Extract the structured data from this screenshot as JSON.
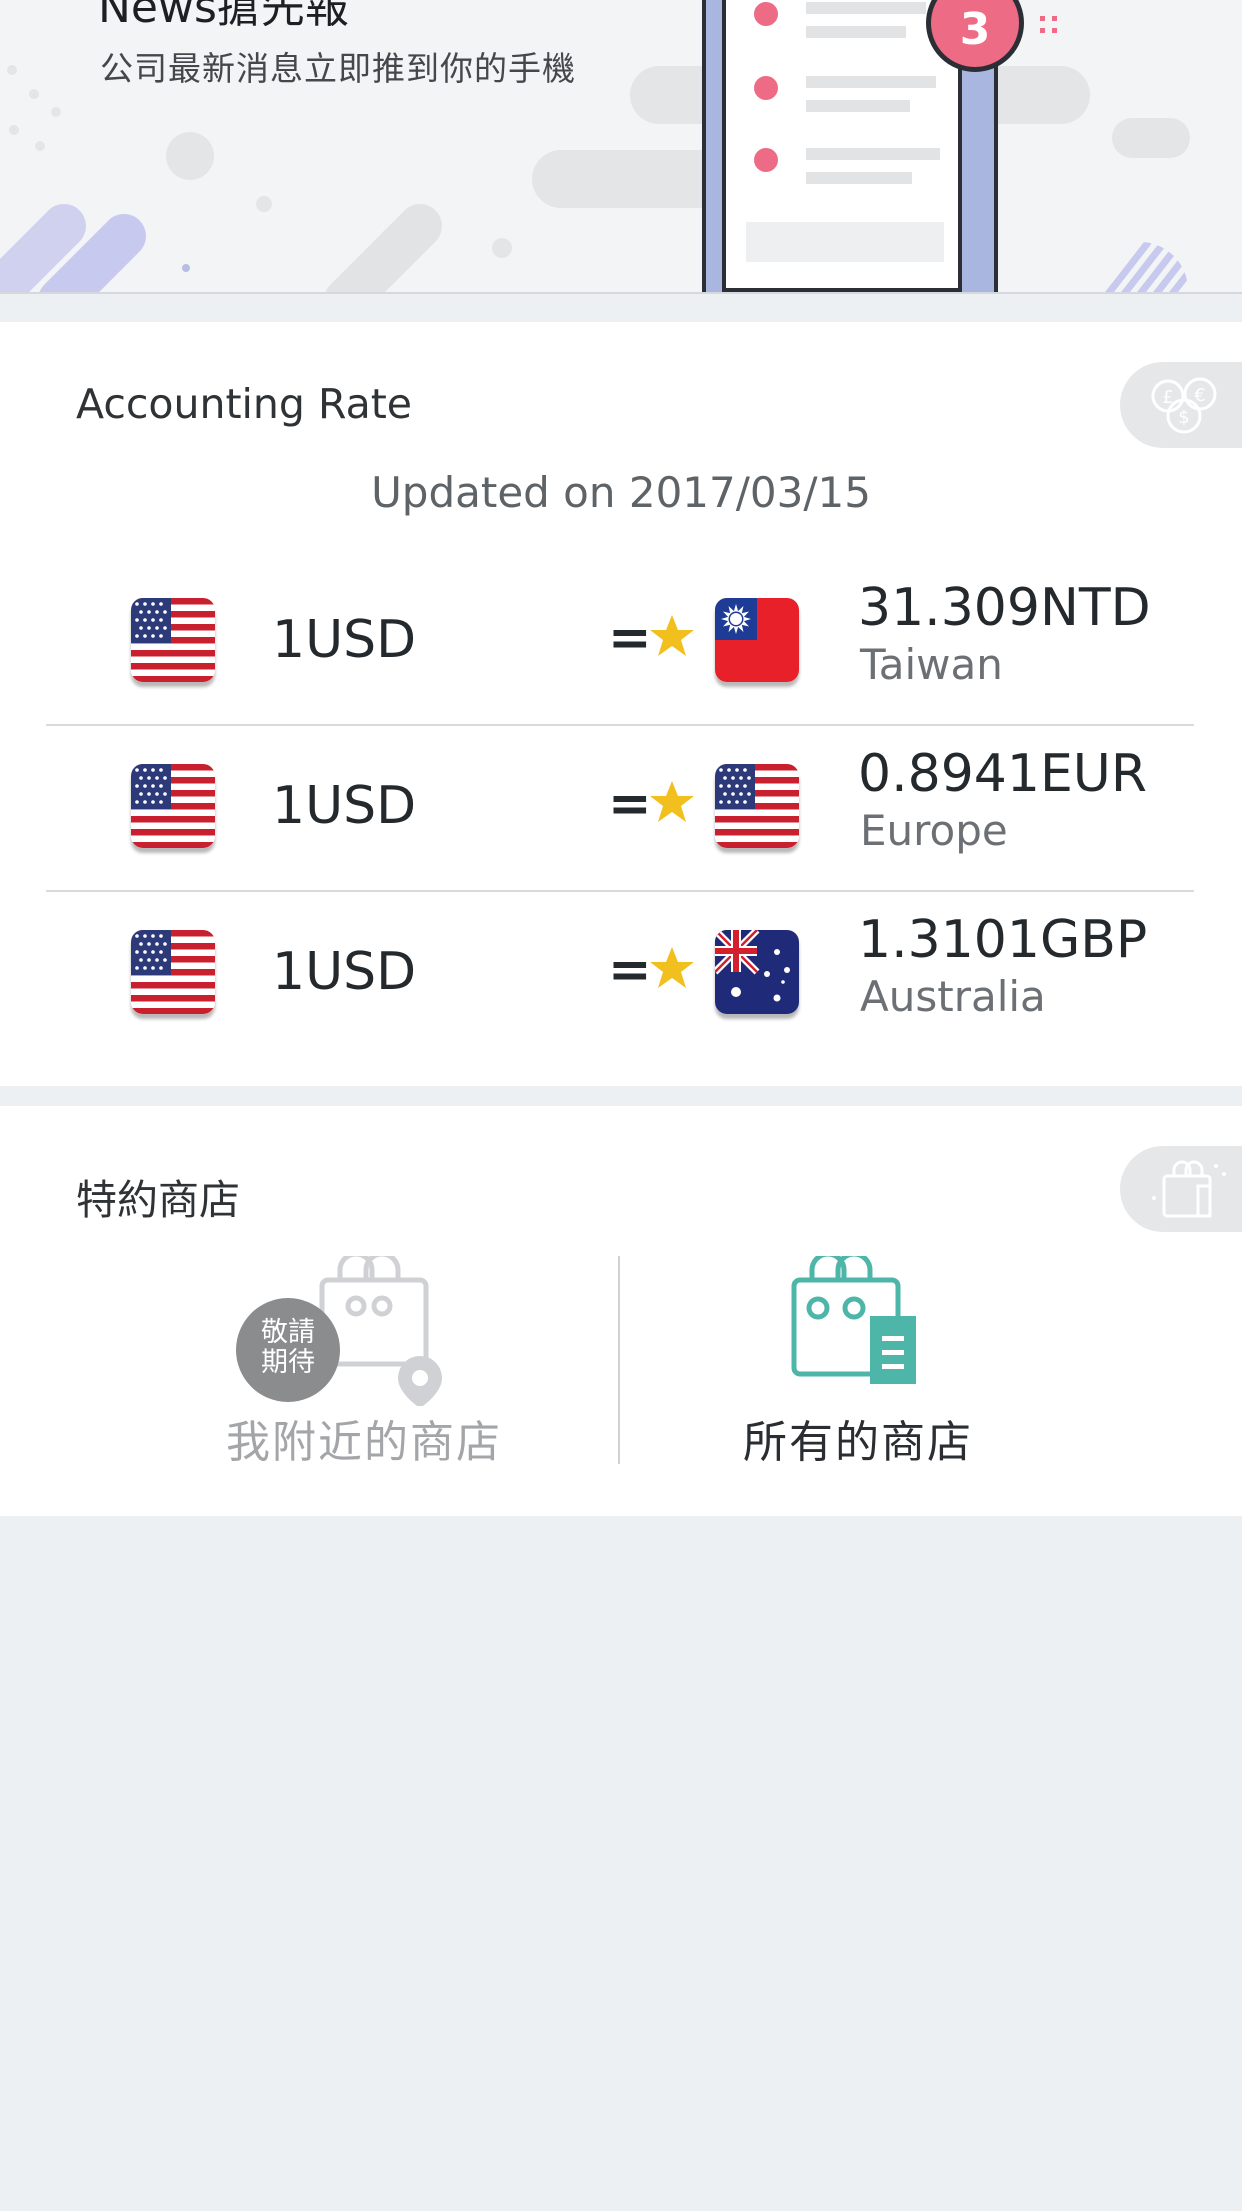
{
  "banner": {
    "title": "News搶先報",
    "subtitle": "公司最新消息立即推到你的手機",
    "notification_count": "3"
  },
  "accounting_rate": {
    "title": "Accounting Rate",
    "updated": "Updated on 2017/03/15",
    "badge_icon": "currency-coins-icon",
    "rows": [
      {
        "from_flag": "us-flag-icon",
        "base": "1USD",
        "equals": "=",
        "to_flag": "taiwan-flag-icon",
        "amount": "31.309NTD",
        "region": "Taiwan"
      },
      {
        "from_flag": "us-flag-icon",
        "base": "1USD",
        "equals": "=",
        "to_flag": "us-flag-icon",
        "amount": "0.8941EUR",
        "region": "Europe"
      },
      {
        "from_flag": "us-flag-icon",
        "base": "1USD",
        "equals": "=",
        "to_flag": "australia-flag-icon",
        "amount": "1.3101GBP",
        "region": "Australia"
      }
    ]
  },
  "stores": {
    "title": "特約商店",
    "badge_icon": "shopping-bag-icon",
    "nearby": {
      "label": "我附近的商店",
      "badge": "敬請期待",
      "icon": "shopping-bag-location-icon"
    },
    "all": {
      "label": "所有的商店",
      "icon": "shopping-bag-list-icon"
    }
  },
  "colors": {
    "background": "#edf0f3",
    "card": "#ffffff",
    "accent_teal": "#4db6a8",
    "star": "#f2c01e",
    "badge_pink": "#ee6b86",
    "muted": "#a3a5a8"
  }
}
